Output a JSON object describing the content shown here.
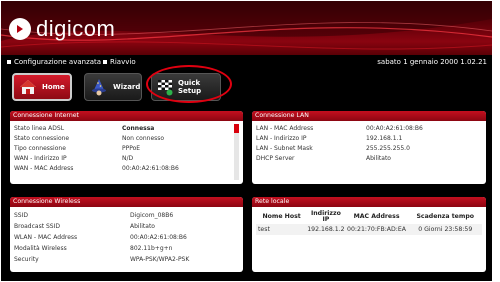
{
  "brand": {
    "logo_text": "digicom"
  },
  "menu": {
    "advanced_label": "Configurazione avanzata",
    "reboot_label": "Riavvio",
    "datetime": "sabato 1 gennaio 2000 1.02.21"
  },
  "nav": {
    "home_label": "Home",
    "wizard_label": "Wizard",
    "quick_setup_label": "Quick Setup"
  },
  "internet": {
    "title": "Connessione Internet",
    "rows": [
      {
        "label": "Stato linea ADSL",
        "value": "Connessa"
      },
      {
        "label": "Stato connessione",
        "value": "Non connesso"
      },
      {
        "label": "Tipo connessione",
        "value": "PPPoE"
      },
      {
        "label": "WAN - Indirizzo IP",
        "value": "N/D"
      },
      {
        "label": "WAN - MAC Address",
        "value": "00:A0:A2:61:08:B6"
      }
    ]
  },
  "lan": {
    "title": "Connessione LAN",
    "rows": [
      {
        "label": "LAN - MAC Address",
        "value": "00:A0:A2:61:08:B6"
      },
      {
        "label": "LAN - Indirizzo IP",
        "value": "192.168.1.1"
      },
      {
        "label": "LAN - Subnet Mask",
        "value": "255.255.255.0"
      },
      {
        "label": "DHCP Server",
        "value": "Abilitato"
      }
    ]
  },
  "wireless": {
    "title": "Connessione Wireless",
    "rows": [
      {
        "label": "SSID",
        "value": "Digicom_08B6"
      },
      {
        "label": "Broadcast SSID",
        "value": "Abilitato"
      },
      {
        "label": "WLAN - MAC Address",
        "value": "00:A0:A2:61:08:B6"
      },
      {
        "label": "Modalità Wireless",
        "value": "802.11b+g+n"
      },
      {
        "label": "Security",
        "value": "WPA-PSK/WPA2-PSK"
      }
    ]
  },
  "rete": {
    "title": "Rete locale",
    "headers": [
      "Nome Host",
      "Indirizzo IP",
      "MAC Address",
      "Scadenza tempo"
    ],
    "rows": [
      [
        "test",
        "192.168.1.2",
        "00:21:70:FB:AD:EA",
        "0 Giorni 23:58:59"
      ]
    ]
  },
  "colors": {
    "accent": "#c40f1f",
    "highlight_ring": "#e00010",
    "status_ok": "#2bb24a"
  },
  "icons": [
    "house-icon",
    "wizard-icon",
    "racing-flag-icon",
    "digicom-logo-icon"
  ]
}
